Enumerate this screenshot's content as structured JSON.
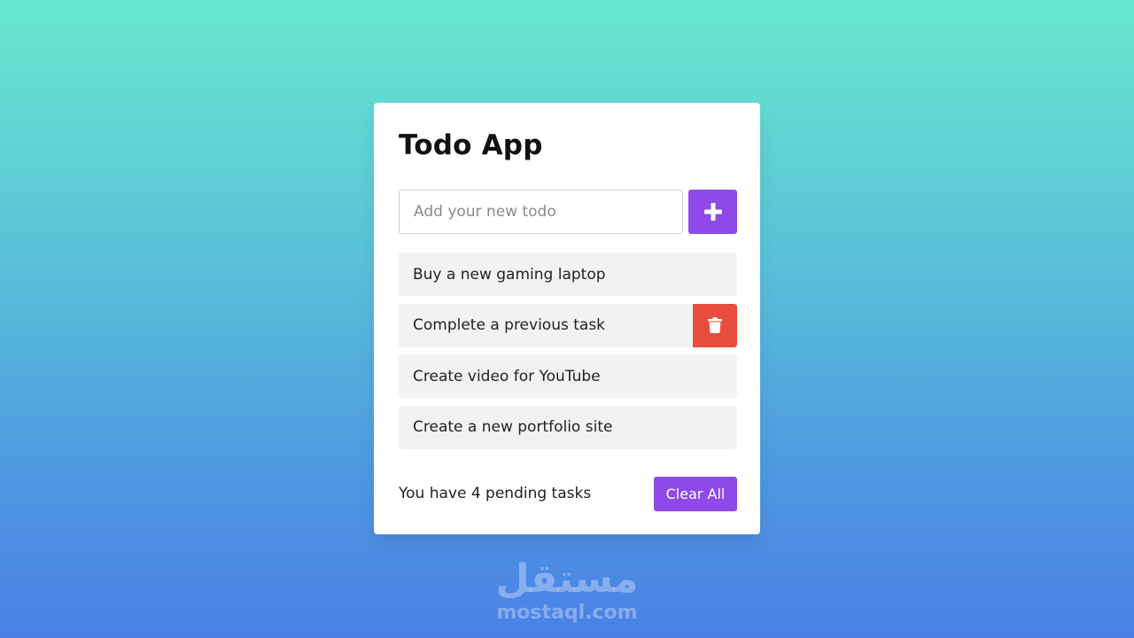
{
  "app": {
    "title": "Todo App"
  },
  "input": {
    "placeholder": "Add your new todo",
    "value": "",
    "add_icon": "plus-icon"
  },
  "todos": [
    {
      "label": "Buy a new gaming laptop"
    },
    {
      "label": "Complete a previous task",
      "hovered": true,
      "delete_icon": "trash-icon"
    },
    {
      "label": "Create video for YouTube"
    },
    {
      "label": "Create a new portfolio site"
    }
  ],
  "footer": {
    "pending_text": "You have 4 pending tasks",
    "clear_label": "Clear All"
  },
  "watermark": {
    "arabic": "مستقل",
    "latin": "mostaql.com"
  },
  "colors": {
    "accent": "#8e49e8",
    "danger": "#e74c3c",
    "item_bg": "#f2f1f3",
    "bg_top": "#67e8cf",
    "bg_bottom": "#4a80e6"
  }
}
